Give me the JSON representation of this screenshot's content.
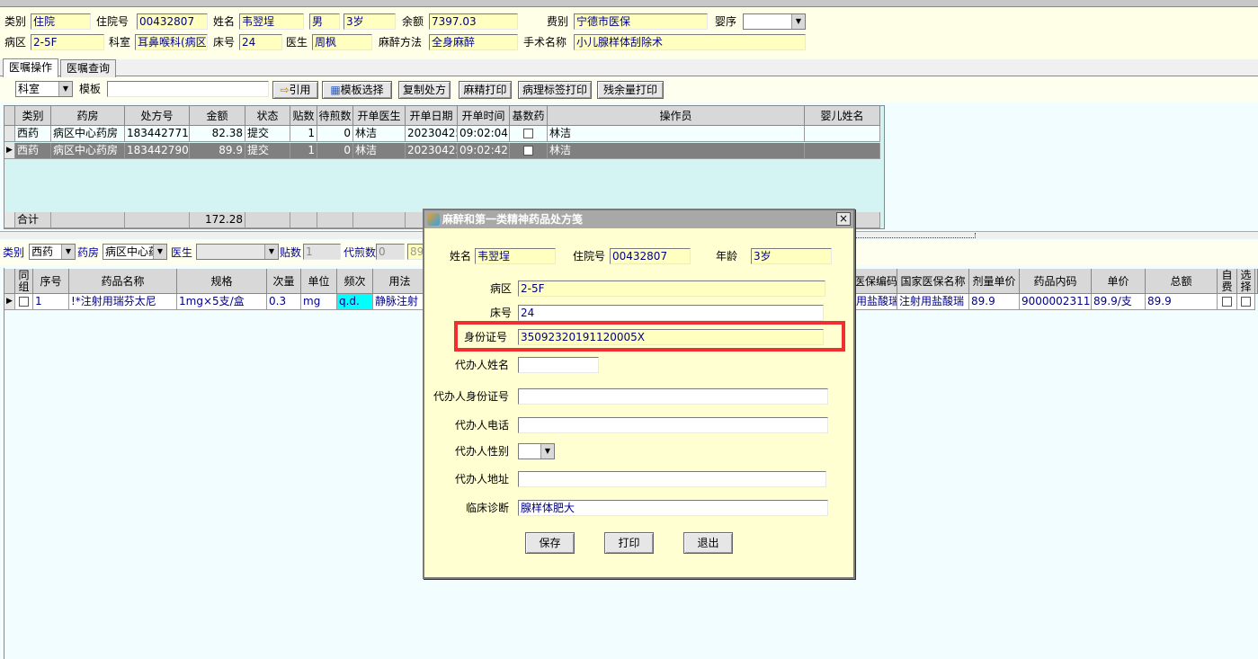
{
  "patient": {
    "type_label": "类别",
    "type_value": "住院",
    "admission_label": "住院号",
    "admission_value": "00432807",
    "name_label": "姓名",
    "name_value": "韦翌埕",
    "sex_value": "男",
    "age_value": "3岁",
    "balance_label": "余额",
    "balance_value": "7397.03",
    "fee_label": "费别",
    "fee_value": "宁德市医保",
    "infant_label": "婴序",
    "ward_label": "病区",
    "ward_value": "2-5F",
    "dept_label": "科室",
    "dept_value": "耳鼻喉科(病区",
    "bed_label": "床号",
    "bed_value": "24",
    "doctor_label": "医生",
    "doctor_value": "周枫",
    "anesthesia_label": "麻醉方法",
    "anesthesia_value": "全身麻醉",
    "surgery_label": "手术名称",
    "surgery_value": "小儿腺样体刮除术"
  },
  "tabs": [
    "医嘱操作",
    "医嘱查询"
  ],
  "toolbar": {
    "dept_select": "科室",
    "template_label": "模板",
    "quote_btn": "引用",
    "template_select_btn": "模板选择",
    "copy_btn": "复制处方",
    "narcotic_print_btn": "麻精打印",
    "pathology_print_btn": "病理标签打印",
    "residual_print_btn": "残余量打印"
  },
  "rx_grid": {
    "headers": [
      "类别",
      "药房",
      "处方号",
      "金额",
      "状态",
      "贴数",
      "待煎数",
      "开单医生",
      "开单日期",
      "开单时间",
      "基数药",
      "操作员",
      "婴儿姓名"
    ],
    "rows": [
      [
        "西药",
        "病区中心药房",
        "183442771",
        "82.38",
        "提交",
        "1",
        "0",
        "林洁",
        "20230425",
        "09:02:04",
        "",
        "林洁",
        ""
      ],
      [
        "西药",
        "病区中心药房",
        "183442790",
        "89.9",
        "提交",
        "1",
        "0",
        "林洁",
        "20230425",
        "09:02:42",
        "",
        "林洁",
        ""
      ]
    ],
    "total_label": "合计",
    "total_value": "172.28"
  },
  "filter": {
    "type_label": "类别",
    "type_value": "西药",
    "pharmacy_label": "药房",
    "pharmacy_value": "病区中心药",
    "doctor_label": "医生",
    "doses_label": "贴数",
    "doses_value": "1",
    "pending_label": "代煎数",
    "pending_value": "0",
    "extra_value": "89"
  },
  "drug_grid": {
    "headers_left": [
      "同组",
      "序号",
      "药品名称",
      "规格",
      "次量",
      "单位",
      "频次",
      "用法"
    ],
    "headers_right": [
      "医保编码",
      "国家医保名称",
      "剂量单价",
      "药品内码",
      "单价",
      "总额",
      "自费",
      "选择"
    ],
    "row_left": [
      "",
      "1",
      "!*注射用瑞芬太尼",
      "1mg×5支/盒",
      "0.3",
      "mg",
      "q.d.",
      "静脉注射"
    ],
    "row_right": [
      "用盐酸瑞",
      "注射用盐酸瑞",
      "89.9",
      "9000002311",
      "89.9/支",
      "89.9",
      "",
      ""
    ]
  },
  "dialog": {
    "title": "麻醉和第一类精神药品处方笺",
    "close": "×",
    "name_label": "姓名",
    "name_value": "韦翌埕",
    "admission_label": "住院号",
    "admission_value": "00432807",
    "age_label": "年龄",
    "age_value": "3岁",
    "ward_label": "病区",
    "ward_value": "2-5F",
    "bed_label": "床号",
    "bed_value": "24",
    "id_label": "身份证号",
    "id_value": "35092320191120005X",
    "agent_name_label": "代办人姓名",
    "agent_name_value": "",
    "agent_id_label": "代办人身份证号",
    "agent_id_value": "",
    "agent_phone_label": "代办人电话",
    "agent_phone_value": "",
    "agent_sex_label": "代办人性别",
    "agent_sex_value": "",
    "agent_addr_label": "代办人地址",
    "agent_addr_value": "",
    "diagnosis_label": "临床诊断",
    "diagnosis_value": "腺样体肥大",
    "save_btn": "保存",
    "print_btn": "打印",
    "exit_btn": "退出"
  },
  "colors": {
    "info_bg": "#ffffe8",
    "field_bg": "#ffffc0",
    "grid_bg": "#d4f4f4",
    "selected_row": "#808080",
    "freq_cell": "#00ffff",
    "highlight_border": "#f03030"
  }
}
